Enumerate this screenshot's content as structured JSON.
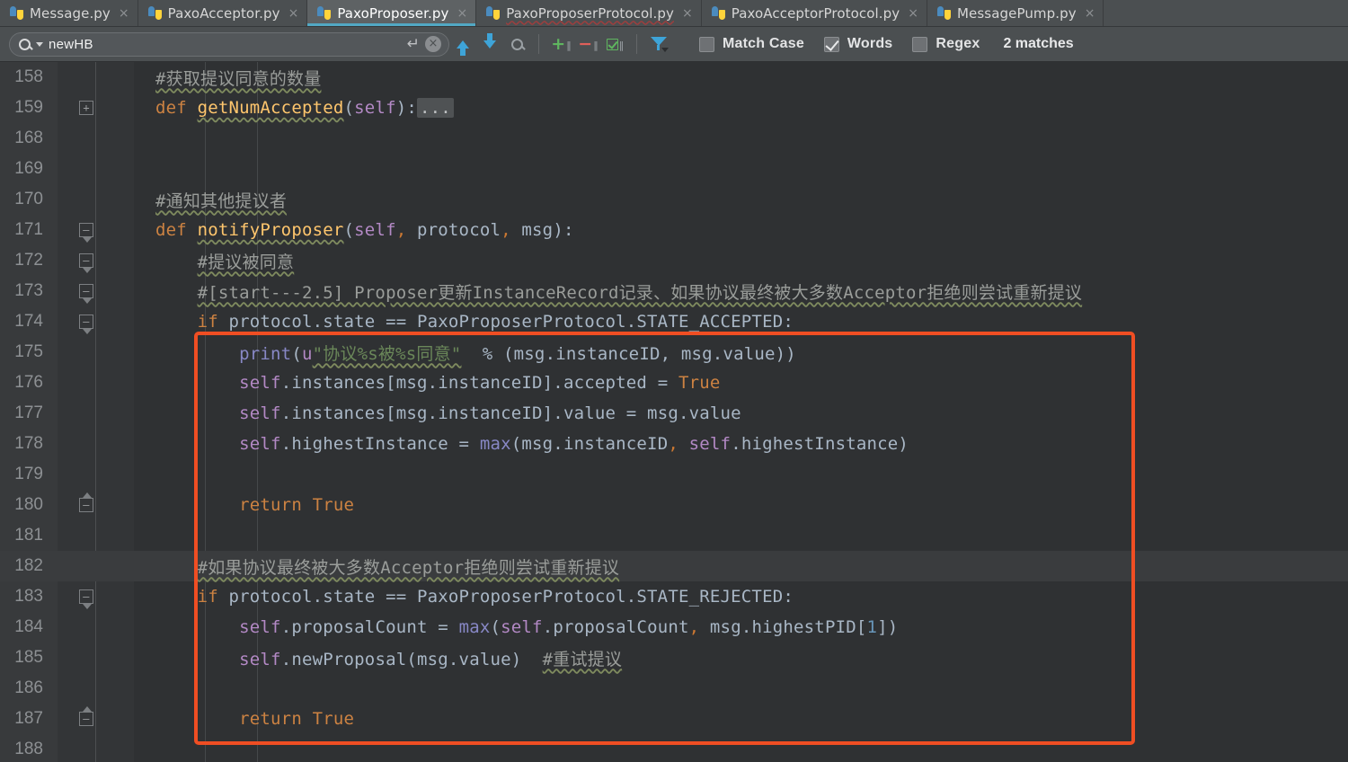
{
  "tabs": [
    {
      "label": "Message.py",
      "active": false,
      "error": false,
      "close": "×"
    },
    {
      "label": "PaxoAcceptor.py",
      "active": false,
      "error": false,
      "close": "×"
    },
    {
      "label": "PaxoProposer.py",
      "active": true,
      "error": false,
      "close": "×"
    },
    {
      "label": "PaxoProposerProtocol.py",
      "active": false,
      "error": true,
      "close": "×"
    },
    {
      "label": "PaxoAcceptorProtocol.py",
      "active": false,
      "error": false,
      "close": "×"
    },
    {
      "label": "MessagePump.py",
      "active": false,
      "error": false,
      "close": "×"
    }
  ],
  "findbar": {
    "search_value": "newHB",
    "search_placeholder": "Search",
    "enter_glyph": "↵",
    "clear_glyph": "×",
    "prev_title": "Previous Occurrence",
    "next_title": "Next Occurrence",
    "find_all_title": "Find All",
    "add_occurrence_glyph": "+",
    "remove_occurrence_glyph": "−",
    "select_all_occurrences_title": "Select All Occurrences",
    "filter_title": "Filter",
    "match_case_label": "Match Case",
    "match_case_checked": false,
    "words_label": "Words",
    "words_checked": true,
    "regex_label": "Regex",
    "regex_checked": false,
    "matches_label": "2 matches"
  },
  "editor": {
    "accent_highlight_color": "#f04e23",
    "current_line": 182,
    "lines": [
      {
        "num": "158",
        "fold": "",
        "indent": 1
      },
      {
        "num": "159",
        "fold": "plus",
        "indent": 1
      },
      {
        "num": "168",
        "fold": "",
        "indent": 0
      },
      {
        "num": "169",
        "fold": "",
        "indent": 0
      },
      {
        "num": "170",
        "fold": "",
        "indent": 1
      },
      {
        "num": "171",
        "fold": "minus-tri",
        "indent": 1
      },
      {
        "num": "172",
        "fold": "minus-tri",
        "indent": 2
      },
      {
        "num": "173",
        "fold": "minus-tri",
        "indent": 2
      },
      {
        "num": "174",
        "fold": "minus-tri",
        "indent": 2
      },
      {
        "num": "175",
        "fold": "",
        "indent": 3
      },
      {
        "num": "176",
        "fold": "",
        "indent": 3
      },
      {
        "num": "177",
        "fold": "",
        "indent": 3
      },
      {
        "num": "178",
        "fold": "",
        "indent": 3
      },
      {
        "num": "179",
        "fold": "",
        "indent": 0
      },
      {
        "num": "180",
        "fold": "minus-up",
        "indent": 3
      },
      {
        "num": "181",
        "fold": "",
        "indent": 0
      },
      {
        "num": "182",
        "fold": "",
        "indent": 2
      },
      {
        "num": "183",
        "fold": "minus-tri",
        "indent": 2
      },
      {
        "num": "184",
        "fold": "",
        "indent": 3
      },
      {
        "num": "185",
        "fold": "",
        "indent": 3
      },
      {
        "num": "186",
        "fold": "",
        "indent": 0
      },
      {
        "num": "187",
        "fold": "minus-up",
        "indent": 3
      },
      {
        "num": "188",
        "fold": "",
        "indent": 0
      }
    ],
    "source_lines": [
      "#获取提议同意的数量",
      "def getNumAccepted(self):...",
      "",
      "",
      "#通知其他提议者",
      "def notifyProposer(self, protocol, msg):",
      "    #提议被同意",
      "    #[start---2.5] Proposer更新InstanceRecord记录、如果协议最终被大多数Acceptor拒绝则尝试重新提议",
      "    if protocol.state == PaxoProposerProtocol.STATE_ACCEPTED:",
      "        print(u\"协议%s被%s同意\"  % (msg.instanceID, msg.value))",
      "        self.instances[msg.instanceID].accepted = True",
      "        self.instances[msg.instanceID].value = msg.value",
      "        self.highestInstance = max(msg.instanceID, self.highestInstance)",
      "",
      "        return True",
      "",
      "    #如果协议最终被大多数Acceptor拒绝则尝试重新提议",
      "    if protocol.state == PaxoProposerProtocol.STATE_REJECTED:",
      "        self.proposalCount = max(self.proposalCount, msg.highestPID[1])",
      "        self.newProposal(msg.value)  #重试提议",
      "",
      "        return True",
      ""
    ]
  }
}
